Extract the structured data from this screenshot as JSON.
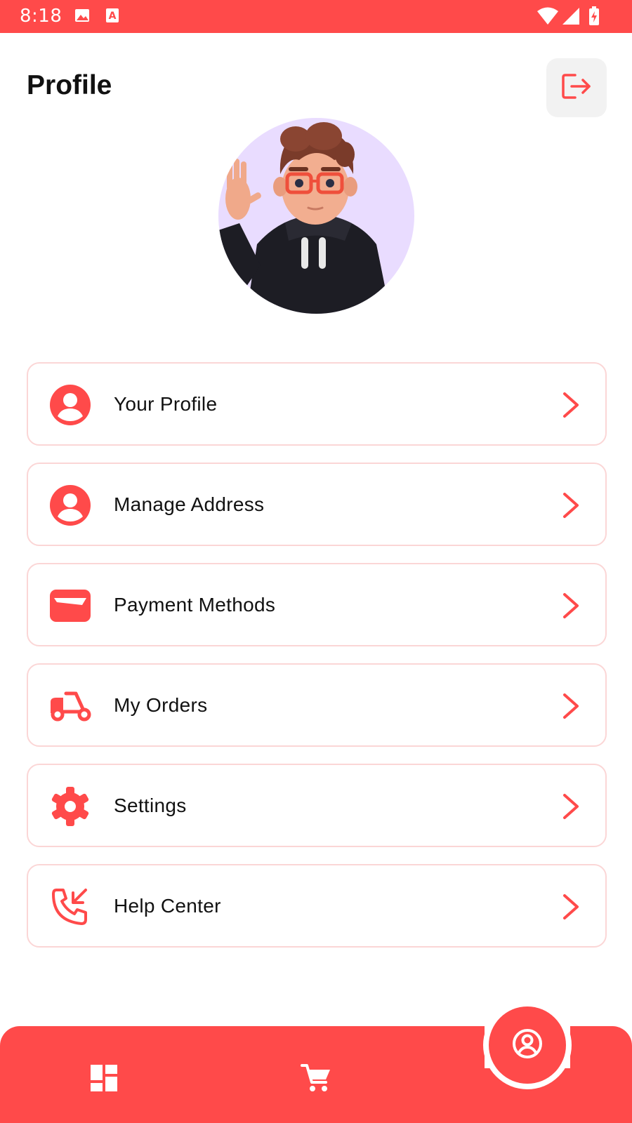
{
  "status_bar": {
    "time": "8:18",
    "icons": [
      "image-icon",
      "text-a-icon",
      "wifi-icon",
      "signal-icon",
      "battery-charging-icon"
    ]
  },
  "header": {
    "title": "Profile",
    "logout_icon": "logout-icon"
  },
  "avatar": {
    "description_icon": "avatar-3d-character"
  },
  "menu": {
    "items": [
      {
        "label": "Your Profile",
        "icon": "user-circle-icon"
      },
      {
        "label": "Manage Address",
        "icon": "user-circle-icon"
      },
      {
        "label": "Payment Methods",
        "icon": "card-icon"
      },
      {
        "label": "My Orders",
        "icon": "scooter-icon"
      },
      {
        "label": "Settings",
        "icon": "gear-icon"
      },
      {
        "label": "Help Center",
        "icon": "phone-incoming-icon"
      }
    ]
  },
  "bottom_nav": {
    "items": [
      {
        "icon": "dashboard-icon"
      },
      {
        "icon": "cart-icon"
      },
      {
        "icon": "profile-circle-icon",
        "active": true
      }
    ]
  },
  "colors": {
    "accent": "#ff4a4a",
    "card_border": "#fbd6d6",
    "avatar_bg": "#e9dcff",
    "logout_bg": "#f2f2f2"
  }
}
